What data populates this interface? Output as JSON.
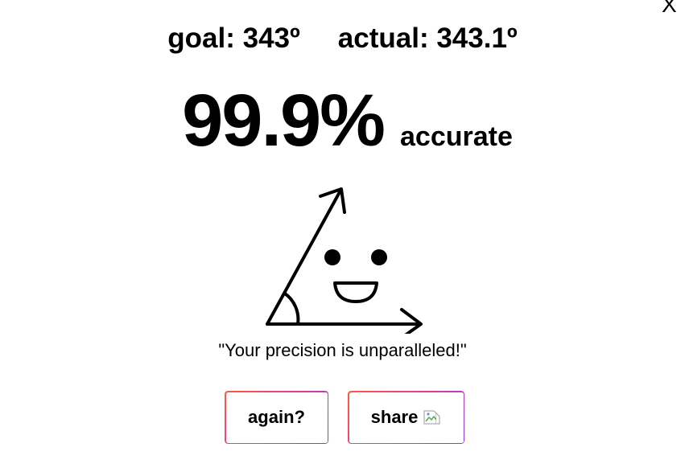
{
  "close": {
    "label": "X"
  },
  "scores": {
    "goal_text": "goal: 343º",
    "actual_text": "actual: 343.1º"
  },
  "result": {
    "accuracy_value": "99.9%",
    "accuracy_label": "accurate"
  },
  "mascot": {
    "icon": "smiling-angle-mascot-icon"
  },
  "quote": "\"Your precision is unparalleled!\"",
  "buttons": {
    "again_label": "again?",
    "share_label": "share",
    "share_icon": "broken-image-icon"
  },
  "colors": {
    "button_border_start": "#ff5a3c",
    "button_border_mid": "#e23a9a",
    "button_border_end": "#7b3cf0"
  }
}
